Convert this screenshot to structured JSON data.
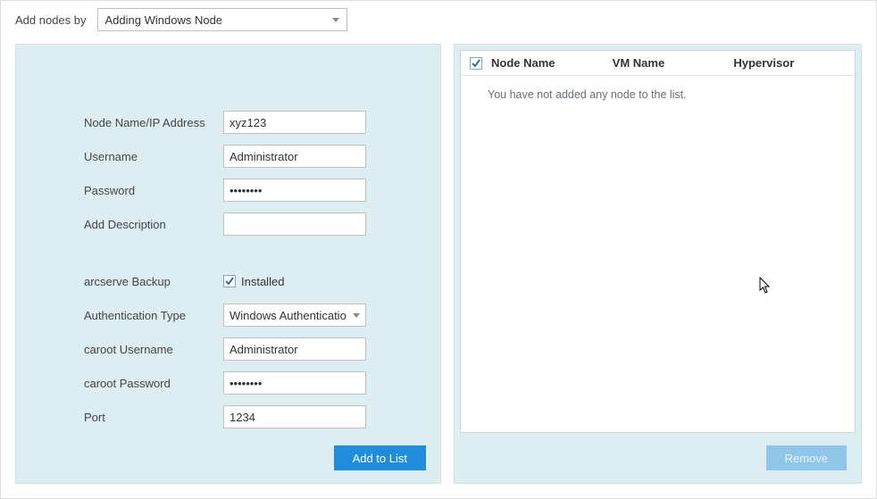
{
  "topbar": {
    "label": "Add nodes by",
    "mode_selected": "Adding Windows Node"
  },
  "form": {
    "node_name_label": "Node Name/IP Address",
    "node_name_value": "xyz123",
    "username_label": "Username",
    "username_value": "Administrator",
    "password_label": "Password",
    "password_value": "••••••••",
    "description_label": "Add Description",
    "description_value": "",
    "arcserve_label": "arcserve Backup",
    "installed_checked": true,
    "installed_label": "Installed",
    "auth_type_label": "Authentication Type",
    "auth_type_selected": "Windows Authenticatio",
    "caroot_user_label": "caroot Username",
    "caroot_user_value": "Administrator",
    "caroot_pw_label": "caroot Password",
    "caroot_pw_value": "••••••••",
    "port_label": "Port",
    "port_value": "1234"
  },
  "buttons": {
    "add_to_list": "Add to List",
    "remove": "Remove"
  },
  "list": {
    "header_select_all_checked": true,
    "col_node_name": "Node Name",
    "col_vm_name": "VM Name",
    "col_hypervisor": "Hypervisor",
    "empty_text": "You have not added any node to the list.",
    "rows": []
  }
}
